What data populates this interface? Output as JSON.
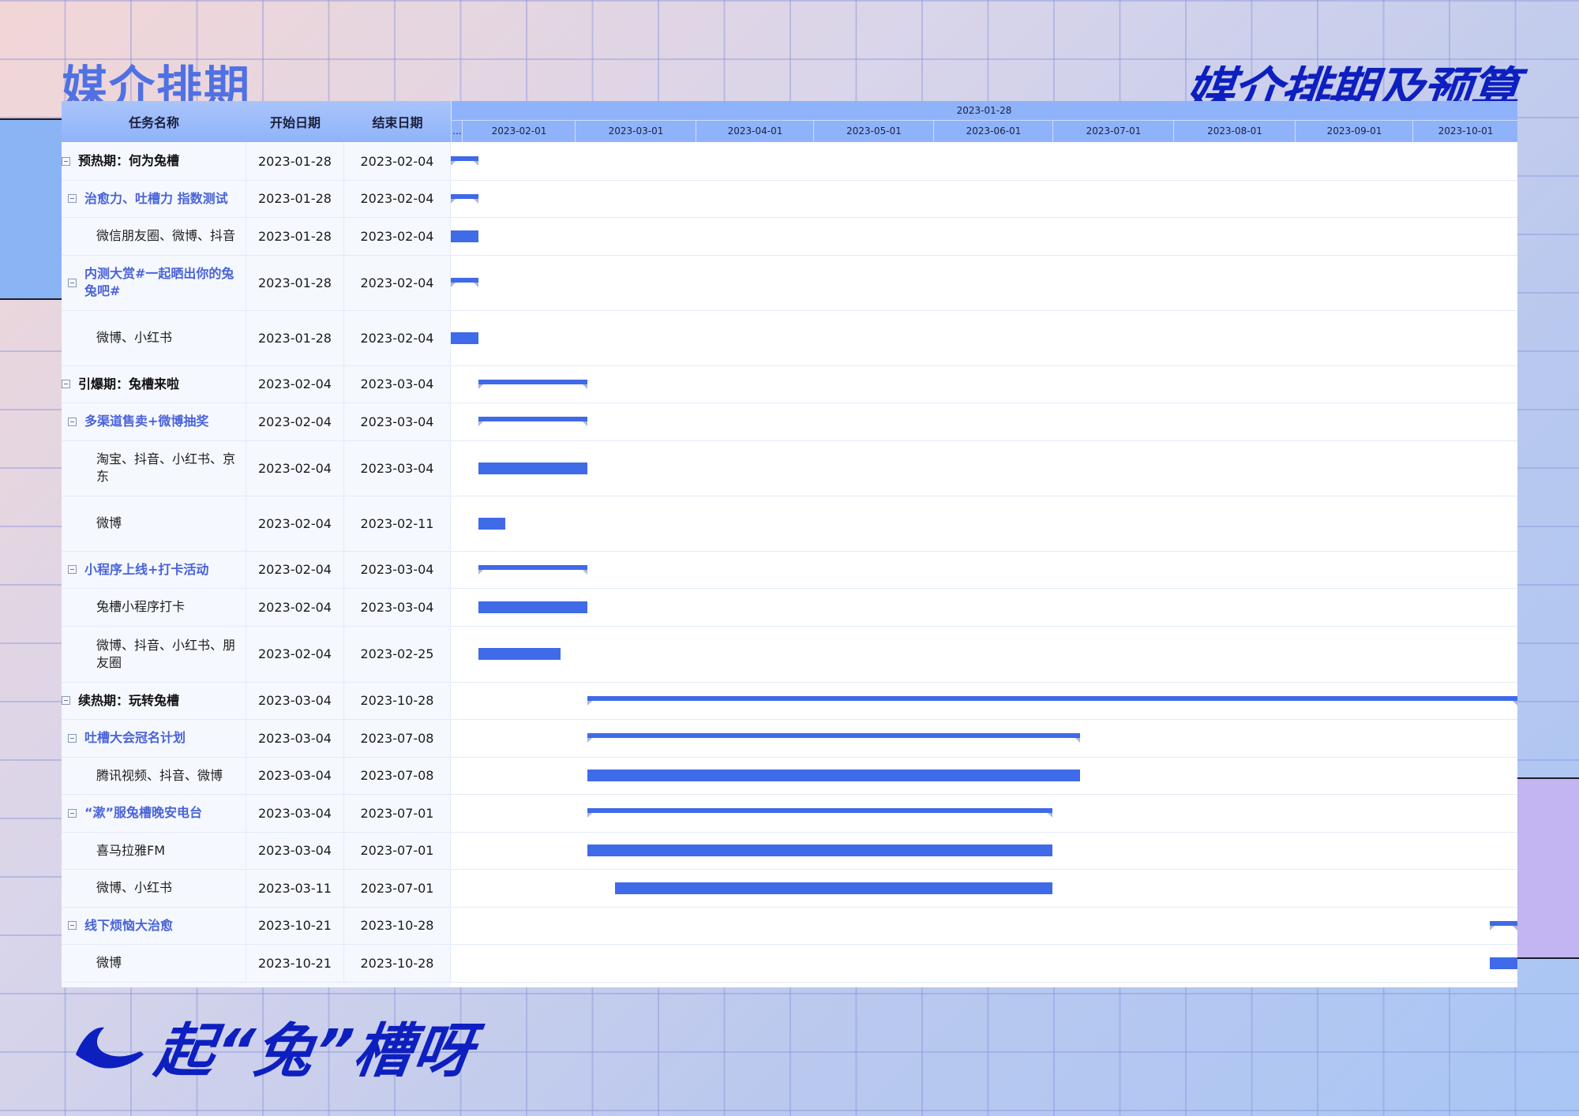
{
  "header": {
    "title_left": "媒介排期",
    "title_right": "媒介排期及预算"
  },
  "table": {
    "columns": [
      "任务名称",
      "开始日期",
      "结束日期"
    ],
    "timeline_top_label": "2023-01-28",
    "timeline_months": [
      "...",
      "2023-02-01",
      "2023-03-01",
      "2023-04-01",
      "2023-05-01",
      "2023-06-01",
      "2023-07-01",
      "2023-08-01",
      "2023-09-01",
      "2023-10-01"
    ],
    "rows": [
      {
        "name": "预热期：何为兔槽",
        "start": "2023-01-28",
        "end": "2023-02-04",
        "level": 0
      },
      {
        "name": "治愈力、吐槽力 指数测试",
        "start": "2023-01-28",
        "end": "2023-02-04",
        "level": 1
      },
      {
        "name": "微信朋友圈、微博、抖音",
        "start": "2023-01-28",
        "end": "2023-02-04",
        "level": 2
      },
      {
        "name": "内测大赏#一起晒出你的兔兔吧#",
        "start": "2023-01-28",
        "end": "2023-02-04",
        "level": 1
      },
      {
        "name": "微博、小红书",
        "start": "2023-01-28",
        "end": "2023-02-04",
        "level": 2
      },
      {
        "name": "引爆期：兔槽来啦",
        "start": "2023-02-04",
        "end": "2023-03-04",
        "level": 0
      },
      {
        "name": "多渠道售卖+微博抽奖",
        "start": "2023-02-04",
        "end": "2023-03-04",
        "level": 1
      },
      {
        "name": "淘宝、抖音、小红书、京东",
        "start": "2023-02-04",
        "end": "2023-03-04",
        "level": 2
      },
      {
        "name": "微博",
        "start": "2023-02-04",
        "end": "2023-02-11",
        "level": 2
      },
      {
        "name": "小程序上线+打卡活动",
        "start": "2023-02-04",
        "end": "2023-03-04",
        "level": 1
      },
      {
        "name": "兔槽小程序打卡",
        "start": "2023-02-04",
        "end": "2023-03-04",
        "level": 2
      },
      {
        "name": "微博、抖音、小红书、朋友圈",
        "start": "2023-02-04",
        "end": "2023-02-25",
        "level": 2
      },
      {
        "name": "续热期：玩转兔槽",
        "start": "2023-03-04",
        "end": "2023-10-28",
        "level": 0
      },
      {
        "name": "吐槽大会冠名计划",
        "start": "2023-03-04",
        "end": "2023-07-08",
        "level": 1
      },
      {
        "name": "腾讯视频、抖音、微博",
        "start": "2023-03-04",
        "end": "2023-07-08",
        "level": 2
      },
      {
        "name": "“漱”服兔槽晚安电台",
        "start": "2023-03-04",
        "end": "2023-07-01",
        "level": 1
      },
      {
        "name": "喜马拉雅FM",
        "start": "2023-03-04",
        "end": "2023-07-01",
        "level": 2
      },
      {
        "name": "微博、小红书",
        "start": "2023-03-11",
        "end": "2023-07-01",
        "level": 2
      },
      {
        "name": "线下烦恼大治愈",
        "start": "2023-10-21",
        "end": "2023-10-28",
        "level": 1
      },
      {
        "name": "微博",
        "start": "2023-10-21",
        "end": "2023-10-28",
        "level": 2
      }
    ]
  },
  "footer": {
    "brand": "起“兔”槽呀"
  },
  "colors": {
    "bar": "#3f6ae8",
    "title_dark": "#0e1fc0",
    "title_light": "#4f71e3",
    "header_bg": "#8fb3fa"
  }
}
